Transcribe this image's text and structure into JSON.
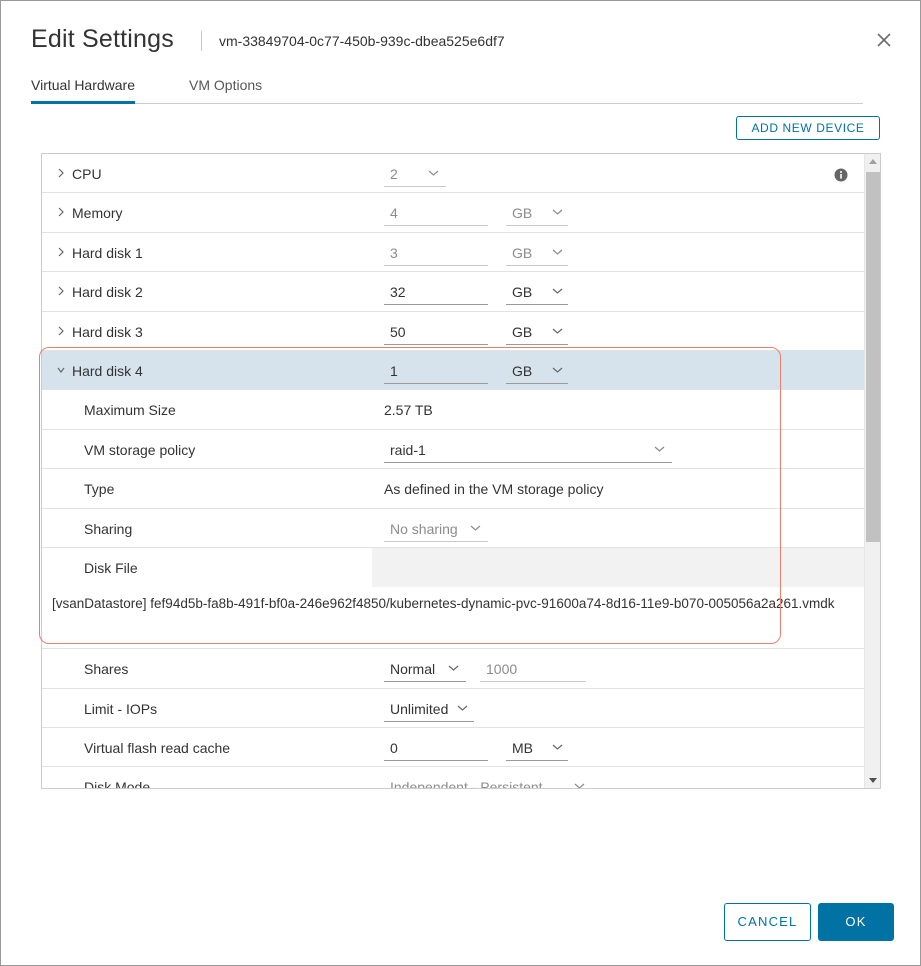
{
  "dialog": {
    "title": "Edit Settings",
    "vm_name": "vm-33849704-0c77-450b-939c-dbea525e6df7"
  },
  "tabs": [
    {
      "label": "Virtual Hardware",
      "active": true
    },
    {
      "label": "VM Options",
      "active": false
    }
  ],
  "toolbar": {
    "add_device_label": "ADD NEW DEVICE"
  },
  "hardware": {
    "cpu": {
      "label": "CPU",
      "value": "2"
    },
    "memory": {
      "label": "Memory",
      "value": "4",
      "unit": "GB"
    },
    "hard_disk_1": {
      "label": "Hard disk 1",
      "value": "3",
      "unit": "GB"
    },
    "hard_disk_2": {
      "label": "Hard disk 2",
      "value": "32",
      "unit": "GB"
    },
    "hard_disk_3": {
      "label": "Hard disk 3",
      "value": "50",
      "unit": "GB"
    },
    "hard_disk_4": {
      "label": "Hard disk 4",
      "value": "1",
      "unit": "GB",
      "max_size_label": "Maximum Size",
      "max_size_value": "2.57 TB",
      "storage_policy_label": "VM storage policy",
      "storage_policy_value": "raid-1",
      "type_label": "Type",
      "type_value": "As defined in the VM storage policy",
      "sharing_label": "Sharing",
      "sharing_value": "No sharing",
      "disk_file_label": "Disk File",
      "disk_file_path": "[vsanDatastore] fef94d5b-fa8b-491f-bf0a-246e962f4850/kubernetes-dynamic-pvc-91600a74-8d16-11e9-b070-005056a2a261.vmdk",
      "shares_label": "Shares",
      "shares_value": "Normal",
      "shares_number": "1000",
      "limit_label": "Limit - IOPs",
      "limit_value": "Unlimited",
      "flash_label": "Virtual flash read cache",
      "flash_value": "0",
      "flash_unit": "MB",
      "disk_mode_label": "Disk Mode",
      "disk_mode_value": "Independent - Persistent"
    }
  },
  "footer": {
    "cancel_label": "CANCEL",
    "ok_label": "OK"
  },
  "colors": {
    "accent": "#0072a3",
    "selected_row": "#d6e3ec",
    "highlight": "#e8806d"
  }
}
